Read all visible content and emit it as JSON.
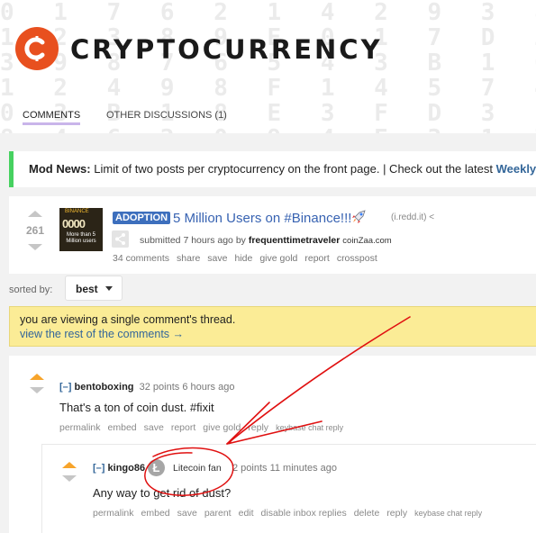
{
  "header": {
    "title": "CRYPTOCURRENCY",
    "tabs": [
      {
        "label": "COMMENTS",
        "active": true
      },
      {
        "label": "OTHER DISCUSSIONS (1)",
        "active": false
      }
    ]
  },
  "mod_news": {
    "label": "Mod News:",
    "text": "Limit of two posts per cryptocurrency on the front page. | Check out the latest",
    "link": "Weekly"
  },
  "post": {
    "score": "261",
    "flair": "ADOPTION",
    "title": "5 Million Users on #Binance!!!",
    "title_icon": "rocket-icon",
    "domain": "(i.redd.it)",
    "submitted_prefix": "submitted 7 hours ago by",
    "author": "frequenttimetraveler",
    "author_flair": "coinZaa.com",
    "thumbnail_text": "0000",
    "thumbnail_caption": "More than 5 Million users",
    "thumbnail_brand": "BINANCE",
    "actions": [
      "34 comments",
      "share",
      "save",
      "hide",
      "give gold",
      "report",
      "crosspost"
    ]
  },
  "sort": {
    "label": "sorted by:",
    "value": "best"
  },
  "notice": {
    "text": "you are viewing a single comment's thread.",
    "link": "view the rest of the comments →"
  },
  "comments": [
    {
      "collapse": "[–]",
      "user": "bentoboxing",
      "meta": "32 points 6 hours ago",
      "body": "That's a ton of coin dust. #fixit",
      "actions": [
        "permalink",
        "embed",
        "save",
        "report",
        "give gold",
        "reply"
      ],
      "extra_action": "keybase chat reply"
    },
    {
      "collapse": "[–]",
      "user": "kingo86",
      "flair_icon": "litecoin-icon",
      "flair_glyph": "Ł",
      "flair": "Litecoin fan",
      "meta": "2 points 11 minutes ago",
      "body": "Any way to get rid of dust?",
      "actions": [
        "permalink",
        "embed",
        "save",
        "parent",
        "edit",
        "disable inbox replies",
        "delete",
        "reply"
      ],
      "extra_action": "keybase chat reply"
    }
  ],
  "colors": {
    "brand": "#e8501f",
    "link": "#336699",
    "mod_news_border": "#46d160",
    "notice_bg": "#fbec96",
    "upvote": "#f7a42b",
    "annotation": "#e01010"
  }
}
